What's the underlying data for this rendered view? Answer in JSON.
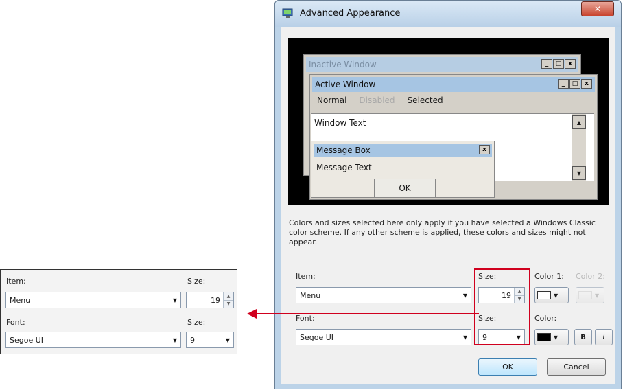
{
  "inset": {
    "item_label": "Item:",
    "item_value": "Menu",
    "size_label": "Size:",
    "size_value": "19",
    "font_label": "Font:",
    "font_value": "Segoe UI",
    "font_size_label": "Size:",
    "font_size_value": "9"
  },
  "dialog": {
    "title": "Advanced Appearance",
    "close_glyph": "✕",
    "preview": {
      "inactive_title": "Inactive Window",
      "active_title": "Active Window",
      "menu_normal": "Normal",
      "menu_disabled": "Disabled",
      "menu_selected": "Selected",
      "window_text": "Window Text",
      "msgbox_title": "Message Box",
      "msgbox_text": "Message Text",
      "msgbox_ok": "OK",
      "min_glyph": "_",
      "max_glyph": "□",
      "close_glyph": "x",
      "up_glyph": "▲",
      "down_glyph": "▼"
    },
    "info_text": "Colors and sizes selected here only apply if you have selected a Windows Classic color scheme. If any other scheme is applied, these colors and sizes might not appear.",
    "item_label": "Item:",
    "item_value": "Menu",
    "size_label": "Size:",
    "size_value": "19",
    "color1_label": "Color 1:",
    "color2_label": "Color 2:",
    "font_label": "Font:",
    "font_value": "Segoe UI",
    "font_size_label": "Size:",
    "font_size_value": "9",
    "font_color_label": "Color:",
    "bold_label": "B",
    "italic_label": "I",
    "ok_label": "OK",
    "cancel_label": "Cancel",
    "colors": {
      "color1": "#ffffff",
      "font_color": "#000000",
      "highlight": "#d0001e"
    }
  }
}
